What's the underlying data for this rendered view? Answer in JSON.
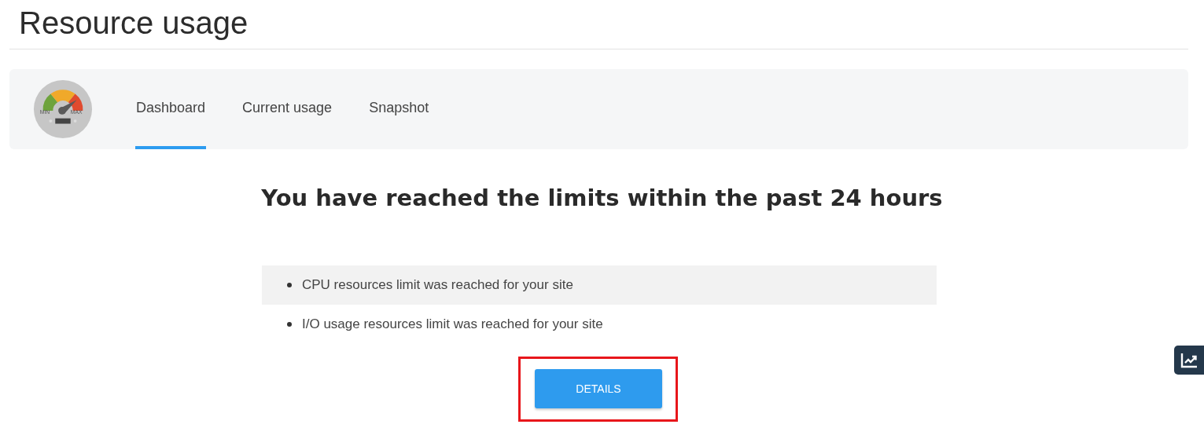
{
  "page_title": "Resource usage",
  "gauge": {
    "min_label": "MIN",
    "max_label": "MAX"
  },
  "tabs": [
    {
      "label": "Dashboard",
      "selected": true
    },
    {
      "label": "Current usage",
      "selected": false
    },
    {
      "label": "Snapshot",
      "selected": false
    }
  ],
  "heading": "You have reached the limits within the past 24 hours",
  "limits": [
    "CPU resources limit was reached for your site",
    "I/O usage resources limit was reached for your site"
  ],
  "details_button": {
    "label": "DETAILS",
    "highlighted": true
  }
}
